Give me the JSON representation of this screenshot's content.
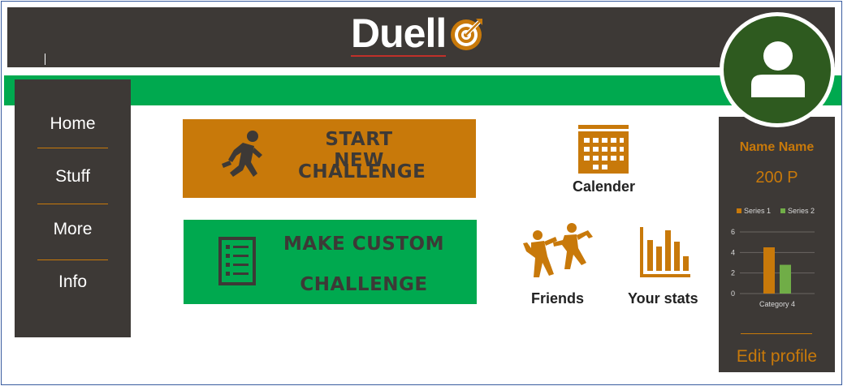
{
  "app": {
    "logo_text": "Duell"
  },
  "sidebar": {
    "items": [
      {
        "label": "Home"
      },
      {
        "label": "Stuff"
      },
      {
        "label": "More"
      },
      {
        "label": "Info"
      }
    ]
  },
  "actions": {
    "start": {
      "line1": "START NEW",
      "line2": "CHALLENGE",
      "icon": "running-person-icon"
    },
    "custom": {
      "line1": "MAKE CUSTOM",
      "line2": "CHALLENGE",
      "icon": "checklist-icon"
    }
  },
  "tiles": {
    "calendar": {
      "label": "Calender",
      "icon": "calendar-icon"
    },
    "friends": {
      "label": "Friends",
      "icon": "friends-dancing-icon"
    },
    "stats": {
      "label": "Your stats",
      "icon": "bar-chart-icon"
    }
  },
  "profile": {
    "name": "Name Name",
    "points": "200 P",
    "edit_label": "Edit profile",
    "avatar_icon": "user-avatar-icon"
  },
  "colors": {
    "dark": "#3d3936",
    "orange": "#c8790a",
    "green": "#00a94f",
    "avatar_green": "#2e5a1f",
    "series2": "#70ad47"
  },
  "chart_data": {
    "type": "bar",
    "categories": [
      "Category 4"
    ],
    "series": [
      {
        "name": "Series 1",
        "values": [
          4.5
        ]
      },
      {
        "name": "Series 2",
        "values": [
          2.8
        ]
      }
    ],
    "ylim": [
      0,
      6
    ],
    "yticks": [
      "0",
      "2",
      "4",
      "6"
    ],
    "legend": "top",
    "grid": true
  }
}
